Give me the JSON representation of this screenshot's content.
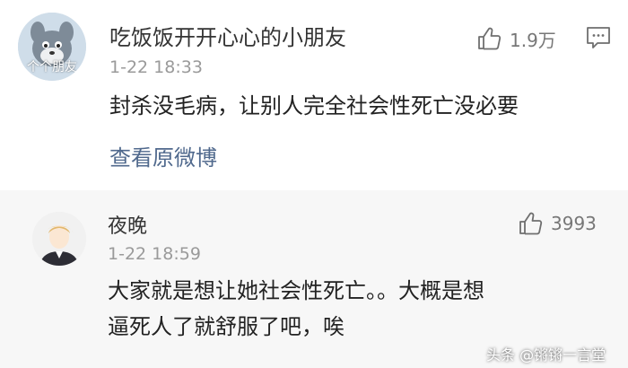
{
  "comments": [
    {
      "username": "吃饭饭开开心心的小朋友",
      "avatar_caption": "个个朋友",
      "timestamp": "1-22 18:33",
      "text": "封杀没毛病，让别人完全社会性死亡没必要",
      "link": "查看原微博",
      "likes": "1.9万",
      "like_icon": "thumbs-up-icon",
      "reply_icon": "comment-icon"
    },
    {
      "username": "夜晚",
      "timestamp": "1-22 18:59",
      "text": "大家就是想让她社会性死亡。。大概是想逼死人了就舒服了吧，唉",
      "likes": "3993",
      "like_icon": "thumbs-up-icon"
    }
  ],
  "watermark": "头条 @锵锵一言堂",
  "colors": {
    "link": "#50698d",
    "background_alt": "#f7f7f7",
    "text": "#222222",
    "meta": "#9a9a9a"
  }
}
